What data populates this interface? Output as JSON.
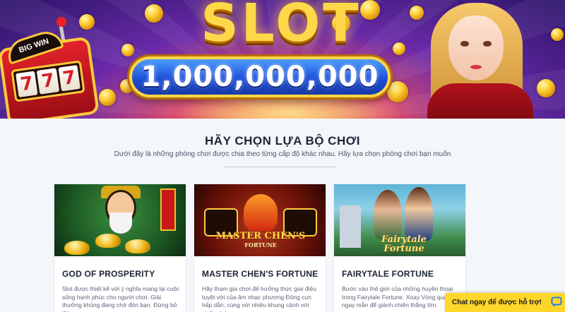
{
  "banner": {
    "title": "SLOT",
    "jackpot": "1,000,000,000",
    "machine_sign": "BIG WIN",
    "reels": [
      "7",
      "7",
      "7"
    ]
  },
  "section": {
    "title": "HÃY CHỌN LỰA BỘ CHƠI",
    "subtitle": "Dưới đây là những phòng chơi được chia theo từng cấp độ khác nhau. Hãy lựa chọn phòng chơi bạn muốn"
  },
  "cards": [
    {
      "name": "GOD OF PROSPERITY",
      "description": "Slot được thiết kế với ý nghĩa mang lại cuộc sống hạnh phúc cho người chơi. Giải thưởng khủng đang chờ đón bạn. Đừng bỏ lỡ!"
    },
    {
      "name": "MASTER CHEN'S FORTUNE",
      "description": "Hãy tham gia chơi để hưởng thức giai điệu tuyệt vời của âm nhạc phương Đông cực hấp dẫn, cùng với nhiều khung cảnh với nhiều tình",
      "logo": "MASTER CHEN'S",
      "logo_sub": "FORTUNE"
    },
    {
      "name": "FAIRYTALE FORTUNE",
      "description": "Bước vào thế giới của những huyền thoại trong Fairytale Fortune. Xoay Vòng quay ngay mẫn để giành chiến thắng lớn.",
      "logo": "Fairytale Fortune"
    }
  ],
  "chat": {
    "label": "Chat ngay để được hỗ trợ!",
    "icon": "chat-bubble-icon"
  },
  "colors": {
    "chat_bg": "#ffd62a",
    "heading": "#1d2638",
    "page_bg": "#f3f6fa"
  }
}
